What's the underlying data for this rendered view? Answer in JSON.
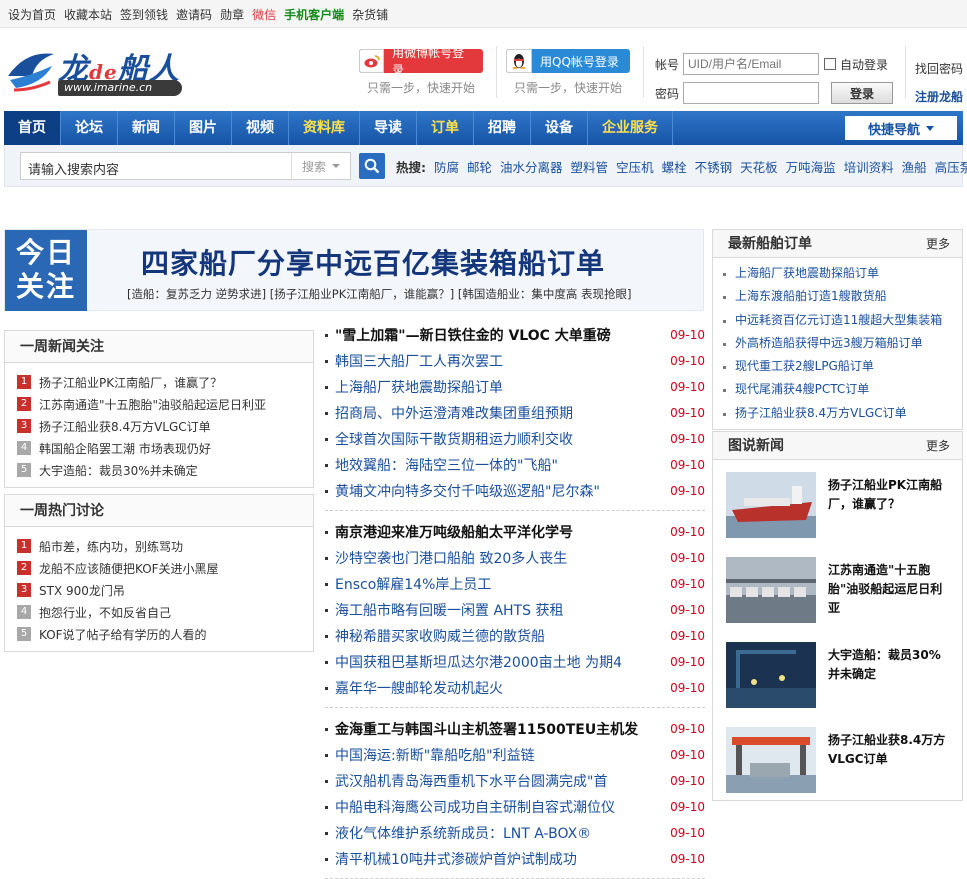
{
  "topbar": {
    "links": [
      {
        "label": "设为首页",
        "style": ""
      },
      {
        "label": "收藏本站",
        "style": ""
      },
      {
        "label": "签到领钱",
        "style": ""
      },
      {
        "label": "邀请码",
        "style": ""
      },
      {
        "label": "勋章",
        "style": ""
      },
      {
        "label": "微信",
        "style": "red"
      },
      {
        "label": "手机客户端",
        "style": "green"
      },
      {
        "label": "杂货铺",
        "style": ""
      }
    ]
  },
  "logo": {
    "name_a": "龙",
    "name_de": "de",
    "name_b": "船人",
    "url": "www.imarine.cn"
  },
  "social": {
    "weibo_label": "用微博帐号登录",
    "weibo_hint": "只需一步，快速开始",
    "qq_label": "用QQ帐号登录",
    "qq_hint": "只需一步，快速开始"
  },
  "login": {
    "account_label": "帐号",
    "account_placeholder": "UID/用户名/Email",
    "password_label": "密码",
    "auto_login": "自动登录",
    "submit": "登录",
    "forgot": "找回密码",
    "register": "注册龙船"
  },
  "nav": {
    "items": [
      {
        "label": "首页",
        "style": "active"
      },
      {
        "label": "论坛",
        "style": ""
      },
      {
        "label": "新闻",
        "style": ""
      },
      {
        "label": "图片",
        "style": ""
      },
      {
        "label": "视频",
        "style": ""
      },
      {
        "label": "资料库",
        "style": "hl"
      },
      {
        "label": "导读",
        "style": ""
      },
      {
        "label": "订单",
        "style": "hl"
      },
      {
        "label": "招聘",
        "style": ""
      },
      {
        "label": "设备",
        "style": ""
      },
      {
        "label": "企业服务",
        "style": "hl"
      }
    ],
    "quick_nav": "快捷导航"
  },
  "search": {
    "placeholder": "请输入搜索内容",
    "select": "搜索",
    "hot_label": "热搜:",
    "hot_words": [
      "防腐",
      "邮轮",
      "油水分离器",
      "塑料管",
      "空压机",
      "螺栓",
      "不锈钢",
      "天花板",
      "万吨海监",
      "培训资料",
      "渔船",
      "高压泵"
    ]
  },
  "headline": {
    "badge_line1": "今日",
    "badge_line2": "关注",
    "title": "四家船厂分享中远百亿集装箱船订单",
    "subs": "[造船：复苏乏力 逆势求进] [扬子江船业PK江南船厂，谁能赢？] [韩国造船业：集中度高 表现抢眼]"
  },
  "weekly_news": {
    "title": "一周新闻关注",
    "items": [
      "扬子江船业PK江南船厂，谁赢了？",
      "江苏南通造\"十五胞胎\"油驳船起运尼日利亚",
      "扬子江船业获8.4万方VLGC订单",
      "韩国船企陷罢工潮 市场表现仍好",
      "大宇造船：裁员30%并未确定"
    ]
  },
  "weekly_hot": {
    "title": "一周热门讨论",
    "items": [
      "船市差，练内功，别练骂功",
      "龙船不应该随便把KOF关进小黑屋",
      "STX 900龙门吊",
      "抱怨行业，不如反省自己",
      "KOF说了帖子给有学历的人看的"
    ]
  },
  "center_news": [
    [
      {
        "title": "\"雪上加霜\"—新日铁住金的 VLOC 大单重磅",
        "date": "09-10",
        "lead": true
      },
      {
        "title": "韩国三大船厂工人再次罢工",
        "date": "09-10"
      },
      {
        "title": "上海船厂获地震勘探船订单",
        "date": "09-10"
      },
      {
        "title": "招商局、中外运澄清难改集团重组预期",
        "date": "09-10"
      },
      {
        "title": "全球首次国际干散货期租运力顺利交收",
        "date": "09-10"
      },
      {
        "title": "地效翼船：海陆空三位一体的\"飞船\"",
        "date": "09-10"
      },
      {
        "title": "黄埔文冲向特多交付千吨级巡逻船\"尼尔森\"",
        "date": "09-10"
      }
    ],
    [
      {
        "title": "南京港迎来准万吨级船舶太平洋化学号",
        "date": "09-10",
        "lead": true
      },
      {
        "title": "沙特空袭也门港口船舶 致20多人丧生",
        "date": "09-10"
      },
      {
        "title": "Ensco解雇14%岸上员工",
        "date": "09-10"
      },
      {
        "title": "海工船市略有回暖一闲置 AHTS 获租",
        "date": "09-10"
      },
      {
        "title": "神秘希腊买家收购威兰德的散货船",
        "date": "09-10"
      },
      {
        "title": "中国获租巴基斯坦瓜达尔港2000亩土地 为期4",
        "date": "09-10"
      },
      {
        "title": "嘉年华一艘邮轮发动机起火",
        "date": "09-10"
      }
    ],
    [
      {
        "title": "金海重工与韩国斗山主机签署11500TEU主机发",
        "date": "09-10",
        "lead": true
      },
      {
        "title": "中国海运:新断\"靠船吃船\"利益链",
        "date": "09-10"
      },
      {
        "title": "武汉船机青岛海西重机下水平台圆满完成\"首",
        "date": "09-10"
      },
      {
        "title": "中船电科海鹰公司成功自主研制自容式潮位仪",
        "date": "09-10"
      },
      {
        "title": "液化气体维护系统新成员：LNT A-BOX®",
        "date": "09-10"
      },
      {
        "title": "清平机械10吨井式渗碳炉首炉试制成功",
        "date": "09-10"
      }
    ]
  ],
  "latest_orders": {
    "title": "最新船舶订单",
    "more": "更多",
    "items": [
      "上海船厂获地震勘探船订单",
      "上海东渡船舶订造1艘散货船",
      "中远耗资百亿元订造11艘超大型集装箱",
      "外高桥造船获得中远3艘万箱船订单",
      "现代重工获2艘LPG船订单",
      "现代尾浦获4艘PCTC订单",
      "扬子江船业获8.4万方VLGC订单"
    ]
  },
  "photo_news": {
    "title": "图说新闻",
    "more": "更多",
    "items": [
      "扬子江船业PK江南船厂，谁赢了？",
      "江苏南通造\"十五胞胎\"油驳船起运尼日利亚",
      "大宇造船：裁员30%并未确定",
      "扬子江船业获8.4万方VLGC订单"
    ]
  }
}
